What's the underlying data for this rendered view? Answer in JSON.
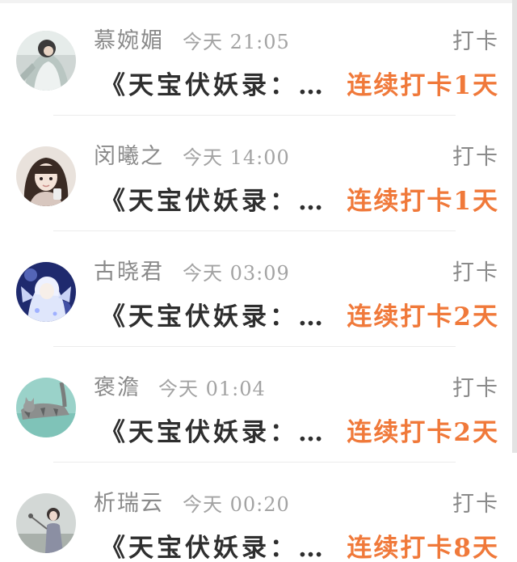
{
  "checkin_list": {
    "items": [
      {
        "name": "慕婉媚",
        "time": "今天 21:05",
        "action": "打卡",
        "title": "《天宝伏妖录：…",
        "streak": "连续打卡1天",
        "avatar_icon": "avatar-girl-white-dress-icon"
      },
      {
        "name": "闵曦之",
        "time": "今天 14:00",
        "action": "打卡",
        "title": "《天宝伏妖录：…",
        "streak": "连续打卡1天",
        "avatar_icon": "avatar-girl-selfie-icon"
      },
      {
        "name": "古晓君",
        "time": "今天 03:09",
        "action": "打卡",
        "title": "《天宝伏妖录：…",
        "streak": "连续打卡2天",
        "avatar_icon": "avatar-anime-angel-icon"
      },
      {
        "name": "褒澹",
        "time": "今天 01:04",
        "action": "打卡",
        "title": "《天宝伏妖录：…",
        "streak": "连续打卡2天",
        "avatar_icon": "avatar-cat-icon"
      },
      {
        "name": "析瑞云",
        "time": "今天 00:20",
        "action": "打卡",
        "title": "《天宝伏妖录：…",
        "streak": "连续打卡8天",
        "avatar_icon": "avatar-child-icon"
      }
    ]
  },
  "colors": {
    "streak": "#f0793a",
    "name": "#8a8a8a",
    "title": "#2e2e2e"
  }
}
